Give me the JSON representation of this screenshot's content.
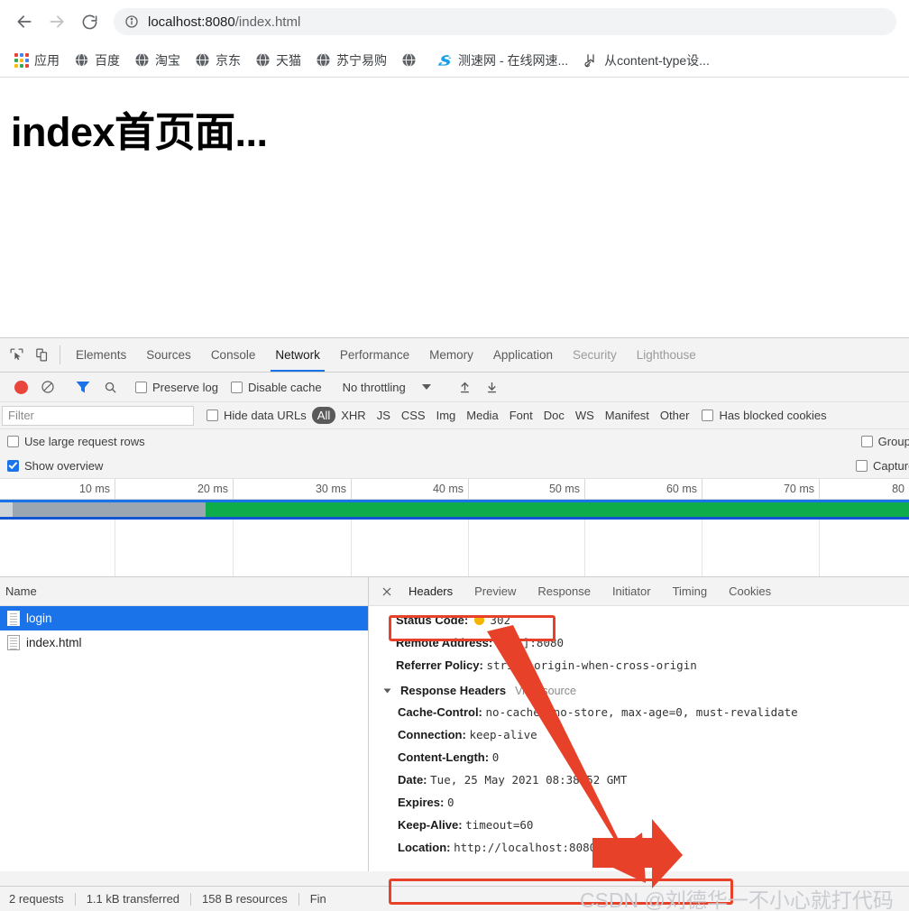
{
  "browser": {
    "nav": {
      "back": "back-arrow",
      "forward": "forward-arrow",
      "reload": "reload"
    },
    "omnibox": {
      "info_icon": "info-circle-icon",
      "url_host": "localhost:8080",
      "url_rest": "/index.html",
      "full_url": "localhost:8080/index.html"
    },
    "bookmarks": [
      {
        "icon": "apps-grid-icon",
        "label": "应用"
      },
      {
        "icon": "globe-icon",
        "label": "百度"
      },
      {
        "icon": "globe-icon",
        "label": "淘宝"
      },
      {
        "icon": "globe-icon",
        "label": "京东"
      },
      {
        "icon": "globe-icon",
        "label": "天猫"
      },
      {
        "icon": "globe-icon",
        "label": "苏宁易购"
      },
      {
        "icon": "globe-icon",
        "label": ""
      },
      {
        "icon": "speedtest-icon",
        "label": "测速网 - 在线网速..."
      },
      {
        "icon": "bookmark-page-icon",
        "label": "从content-type设..."
      }
    ]
  },
  "page": {
    "heading": "index首页面..."
  },
  "devtools": {
    "inspect_icon": "cursor-inspect-icon",
    "device_icon": "device-toolbar-icon",
    "tabs": [
      {
        "label": "Elements",
        "active": false
      },
      {
        "label": "Sources",
        "active": false
      },
      {
        "label": "Console",
        "active": false
      },
      {
        "label": "Network",
        "active": true
      },
      {
        "label": "Performance",
        "active": false
      },
      {
        "label": "Memory",
        "active": false
      },
      {
        "label": "Application",
        "active": false
      },
      {
        "label": "Security",
        "active": false
      },
      {
        "label": "Lighthouse",
        "active": false
      }
    ],
    "toolbar": {
      "record_icon": "record-stop-icon",
      "clear_icon": "clear-no-entry-icon",
      "filter_icon": "funnel-filter-icon",
      "search_icon": "search-magnifier-icon",
      "preserve_log_label": "Preserve log",
      "preserve_log_checked": false,
      "disable_cache_label": "Disable cache",
      "disable_cache_checked": false,
      "throttling_value": "No throttling",
      "import_icon": "import-har-icon",
      "export_icon": "export-har-icon"
    },
    "filterbar": {
      "filter_placeholder": "Filter",
      "filter_value": "",
      "hide_data_urls_label": "Hide data URLs",
      "hide_data_urls_checked": false,
      "types": [
        "All",
        "XHR",
        "JS",
        "CSS",
        "Img",
        "Media",
        "Font",
        "Doc",
        "WS",
        "Manifest",
        "Other"
      ],
      "active_type": "All",
      "has_blocked_cookies_label": "Has blocked cookies",
      "has_blocked_cookies_checked": false
    },
    "options": {
      "use_large_request_rows_label": "Use large request rows",
      "use_large_request_rows_checked": false,
      "group_by_frame_label": "Group by frame",
      "group_by_frame_checked": false,
      "show_overview_label": "Show overview",
      "show_overview_checked": true,
      "capture_screenshots_label": "Capture screenshots",
      "capture_screenshots_checked": false
    },
    "overview": {
      "ticks": [
        "10 ms",
        "20 ms",
        "30 ms",
        "40 ms",
        "50 ms",
        "60 ms",
        "70 ms",
        "80"
      ],
      "colors": {
        "blue_line": "#1a73e8",
        "grey_bar": "#9aa6b2",
        "green_bar": "#0fac4b"
      }
    },
    "requests": {
      "column_header": "Name",
      "rows": [
        {
          "name": "login",
          "selected": true
        },
        {
          "name": "index.html",
          "selected": false
        }
      ]
    },
    "detail": {
      "close_icon": "close-x-icon",
      "tabs": [
        {
          "label": "Headers",
          "active": true
        },
        {
          "label": "Preview",
          "active": false
        },
        {
          "label": "Response",
          "active": false
        },
        {
          "label": "Initiator",
          "active": false
        },
        {
          "label": "Timing",
          "active": false
        },
        {
          "label": "Cookies",
          "active": false
        }
      ],
      "general": [
        {
          "key": "Status Code:",
          "value": "302",
          "has_dot": true
        },
        {
          "key": "Remote Address:",
          "value": "[::1]:8080",
          "has_dot": false
        },
        {
          "key": "Referrer Policy:",
          "value": "strict-origin-when-cross-origin",
          "has_dot": false
        }
      ],
      "response_headers_title": "Response Headers",
      "view_source_label": "View source",
      "response_headers": [
        {
          "key": "Cache-Control:",
          "value": "no-cache, no-store, max-age=0, must-revalidate"
        },
        {
          "key": "Connection:",
          "value": "keep-alive"
        },
        {
          "key": "Content-Length:",
          "value": "0"
        },
        {
          "key": "Date:",
          "value": "Tue, 25 May 2021 08:38:52 GMT"
        },
        {
          "key": "Expires:",
          "value": "0"
        },
        {
          "key": "Keep-Alive:",
          "value": "timeout=60"
        },
        {
          "key": "Location:",
          "value": "http://localhost:8080/index.html"
        }
      ]
    },
    "statusbar": {
      "requests": "2 requests",
      "transferred": "1.1 kB transferred",
      "resources": "158 B resources",
      "finish": "Fin"
    }
  },
  "annotations": {
    "watermark": "CSDN @刘德华一不小心就打代码",
    "highlight_color": "#e8412a",
    "arrow_color": "#e8412a"
  }
}
